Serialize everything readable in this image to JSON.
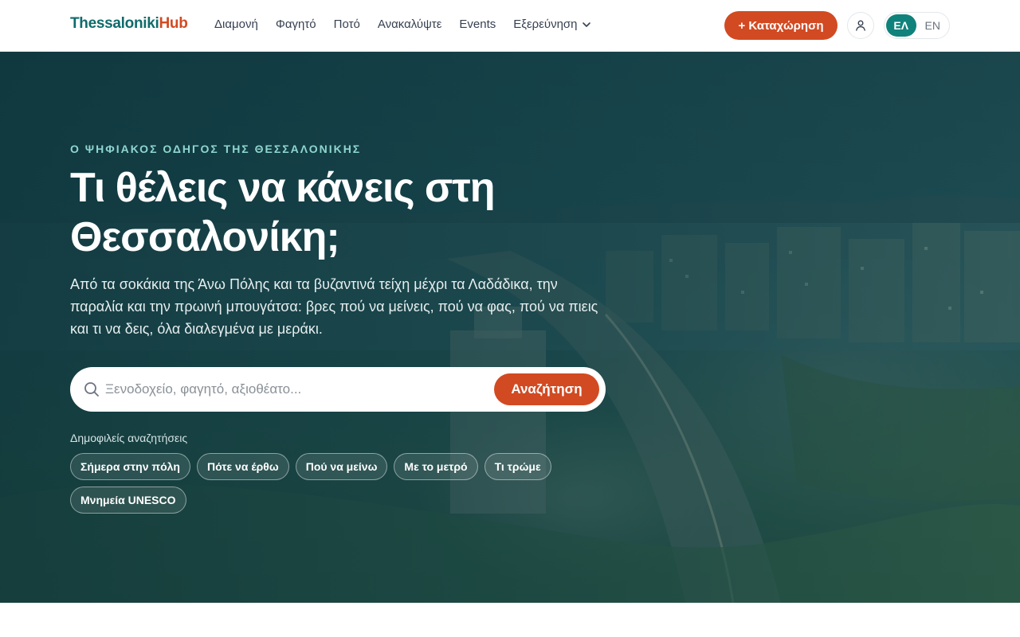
{
  "brand": {
    "part1": "Thessaloniki",
    "part2": "Hub"
  },
  "nav": {
    "items": [
      {
        "label": "Διαμονή"
      },
      {
        "label": "Φαγητό"
      },
      {
        "label": "Ποτό"
      },
      {
        "label": "Ανακαλύψτε"
      },
      {
        "label": "Events"
      },
      {
        "label": "Εξερεύνηση",
        "icon": "chevron-down-icon"
      }
    ]
  },
  "header": {
    "listing_label": "+ Καταχώρηση",
    "user_icon": "user-icon",
    "lang_active": "ΕΛ",
    "lang_other": "EN"
  },
  "hero": {
    "eyebrow": "Ο ΨΗΦΙΑΚΟΣ ΟΔΗΓΟΣ ΤΗΣ ΘΕΣΣΑΛΟΝΙΚΗΣ",
    "title": "Τι θέλεις να κάνεις στη Θεσσαλονίκη;",
    "subtitle": "Από τα σοκάκια της Άνω Πόλης και τα βυζαντινά τείχη μέχρι τα Λαδάδικα, την παραλία και την πρωινή μπουγάτσα: βρες πού να μείνεις, πού να φας, πού να πιεις και τι να δεις, όλα διαλεγμένα με μεράκι.",
    "search_placeholder": "Ξενοδοχείο, φαγητό, αξιοθέατο...",
    "search_value": "",
    "search_button": "Αναζήτηση",
    "popular_label": "Δημοφιλείς αναζητήσεις",
    "chips": [
      "Σήμερα στην πόλη",
      "Πότε να έρθω",
      "Πού να μείνω",
      "Με το μετρό",
      "Τι τρώμε",
      "Μνημεία UNESCO"
    ]
  },
  "colors": {
    "brand_teal": "#0f6b6b",
    "brand_orange": "#d24a22",
    "lang_active_bg": "#10827c",
    "eyebrow": "#8fd6cf"
  }
}
